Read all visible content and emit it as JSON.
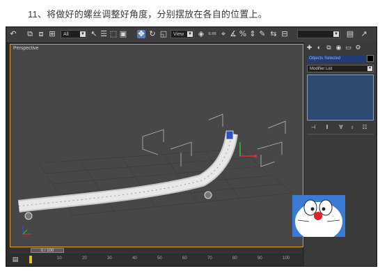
{
  "caption": "11、将做好的螺丝调整好角度，分别摆放在各自的位置上。",
  "toolbar": {
    "filter_select": "All",
    "refcoord_select": "View",
    "snap_value": "0.00",
    "named_selection": ""
  },
  "viewport": {
    "label": "Perspective"
  },
  "command_panel": {
    "object_name": "Objects Selected",
    "modifier_list": "Modifier List"
  },
  "timeline": {
    "slider": "0 / 100",
    "ticks": [
      "10",
      "20",
      "30",
      "40",
      "50",
      "60",
      "70",
      "80",
      "90",
      "100"
    ]
  },
  "colors": {
    "viewport_border": "#e0a030",
    "selection_blue": "#1f3b7a",
    "background": "#474747"
  }
}
